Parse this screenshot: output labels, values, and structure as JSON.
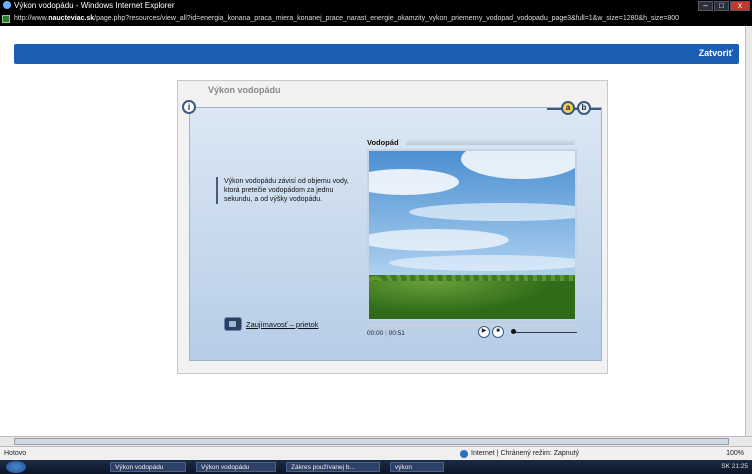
{
  "window": {
    "title": "Výkon vodopádu - Windows Internet Explorer",
    "url_prefix": "http://www.",
    "url_host": "naucteviac.sk",
    "url_rest": "/page.php?resources/view_all?id=energia_konana_praca_miera_konanej_prace_narast_energie_okamzity_vykon_priemerny_vodopad_vodopadu_page3&full=1&w_size=1280&h_size=800"
  },
  "header": {
    "close_label": "Zatvoriť"
  },
  "panel": {
    "title": "Výkon vodopádu",
    "info_label": "i",
    "option_a": "a",
    "option_b": "b",
    "description": "Výkon vodopádu závisí od objemu vody, ktorá pretečie vodopádom za jednu sekundu, a od výšky vodopádu.",
    "aside_link": "Zaujímavosť – prietok"
  },
  "video": {
    "label": "Vodopád",
    "current_time": "00:00",
    "separator": "|",
    "duration": "00:51",
    "progress": 0.0,
    "play_icon": "▶",
    "stop_icon": "■"
  },
  "status": {
    "left": "Hotovo",
    "zone": "Internet | Chránený režim: Zapnutý",
    "zoom": "100%"
  },
  "taskbar": {
    "tasks": [
      "Výkon vodopádu",
      "Výkon vodopádu",
      "Zákres používanej b...",
      "výkon"
    ],
    "tray": "SK 21:25"
  }
}
